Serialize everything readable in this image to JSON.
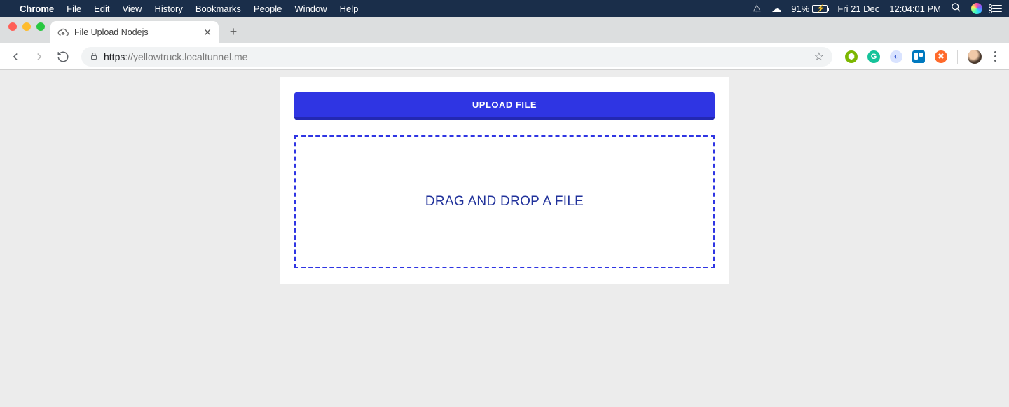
{
  "menubar": {
    "app": "Chrome",
    "items": [
      "File",
      "Edit",
      "View",
      "History",
      "Bookmarks",
      "People",
      "Window",
      "Help"
    ],
    "battery": "91%",
    "date": "Fri 21 Dec",
    "time": "12:04:01 PM"
  },
  "browser": {
    "tab_title": "File Upload Nodejs",
    "url_scheme": "https",
    "url_host": "://yellowtruck.localtunnel.me"
  },
  "page": {
    "upload_button": "UPLOAD FILE",
    "dropzone_text": "DRAG AND DROP A FILE"
  },
  "colors": {
    "accent": "#2f35e3",
    "menubar_bg": "#1a2e4a"
  }
}
